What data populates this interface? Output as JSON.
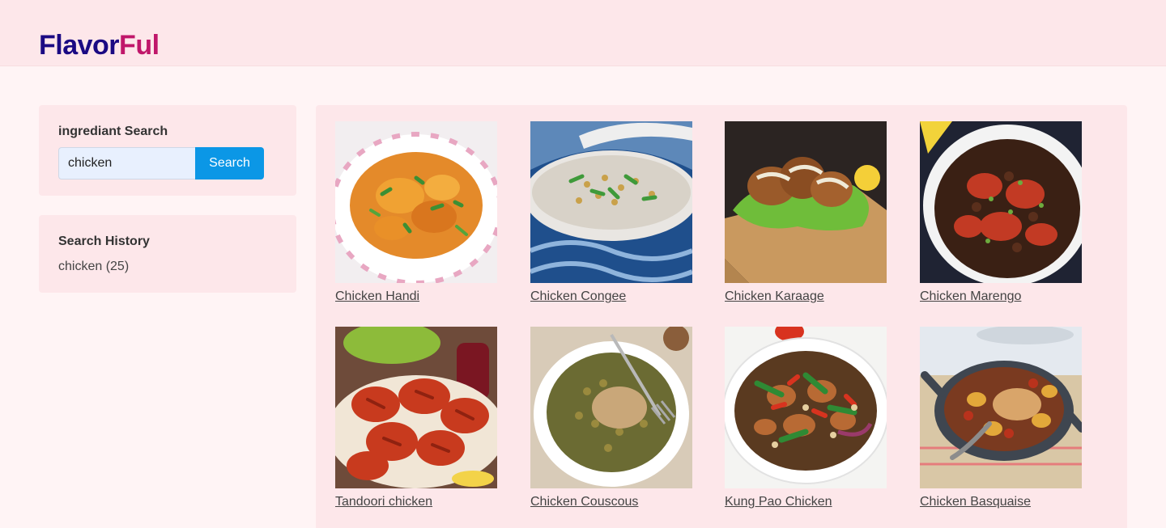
{
  "header": {
    "logo_part1": "Flavor",
    "logo_part2": "Ful"
  },
  "search": {
    "title": "ingrediant Search",
    "value": "chicken",
    "button_label": "Search"
  },
  "history": {
    "title": "Search History",
    "items": [
      "chicken (25)"
    ]
  },
  "recipes": [
    {
      "name": "Chicken Handi"
    },
    {
      "name": "Chicken Congee"
    },
    {
      "name": "Chicken Karaage"
    },
    {
      "name": "Chicken Marengo"
    },
    {
      "name": "Tandoori chicken"
    },
    {
      "name": "Chicken Couscous"
    },
    {
      "name": "Kung Pao Chicken"
    },
    {
      "name": "Chicken Basquaise"
    }
  ]
}
